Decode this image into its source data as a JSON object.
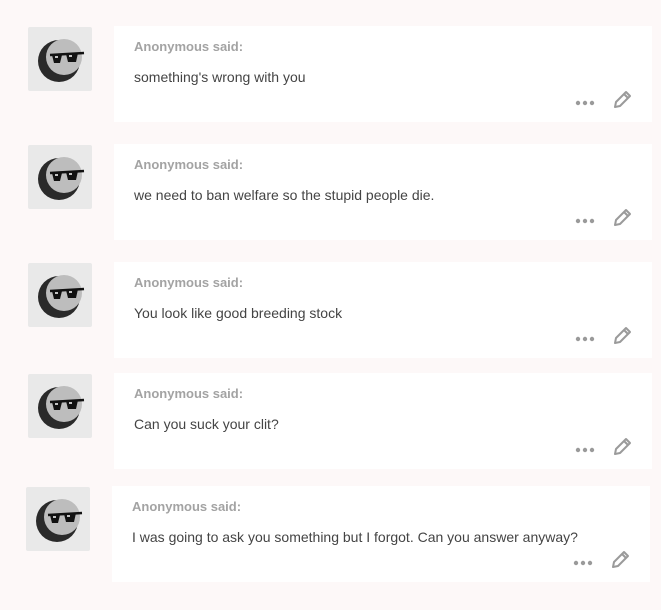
{
  "colors": {
    "background": "#fdf8f8",
    "card": "#ffffff",
    "asker_text": "#a3a3a3",
    "question_text": "#444444",
    "icon": "#9a9a9a",
    "avatar_bg": "#e9e9e9"
  },
  "icons": {
    "avatar": "anonymous-sunglasses-avatar-icon",
    "more": "more-options-icon",
    "edit": "pencil-edit-icon"
  },
  "questions": [
    {
      "asker": "Anonymous said:",
      "text": "something's wrong with you"
    },
    {
      "asker": "Anonymous said:",
      "text": "we need to ban welfare so the stupid people die."
    },
    {
      "asker": "Anonymous said:",
      "text": "You look like good breeding stock"
    },
    {
      "asker": "Anonymous said:",
      "text": "Can you suck your clit?"
    },
    {
      "asker": "Anonymous said:",
      "text": "I was going to ask you something but I forgot. Can you answer anyway?"
    }
  ]
}
